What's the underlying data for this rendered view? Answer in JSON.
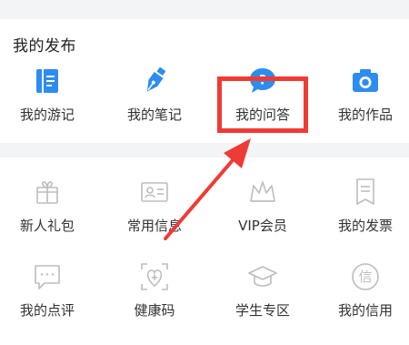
{
  "section_publish": {
    "title": "我的发布",
    "items": [
      {
        "label": "我的游记",
        "icon": "book-icon"
      },
      {
        "label": "我的笔记",
        "icon": "pen-icon"
      },
      {
        "label": "我的问答",
        "icon": "question-bubble-icon"
      },
      {
        "label": "我的作品",
        "icon": "camera-icon"
      }
    ]
  },
  "section_services": {
    "items": [
      {
        "label": "新人礼包",
        "icon": "gift-icon"
      },
      {
        "label": "常用信息",
        "icon": "id-card-icon"
      },
      {
        "label": "VIP会员",
        "icon": "crown-icon"
      },
      {
        "label": "我的发票",
        "icon": "invoice-icon"
      },
      {
        "label": "我的点评",
        "icon": "comment-icon"
      },
      {
        "label": "健康码",
        "icon": "health-code-icon"
      },
      {
        "label": "学生专区",
        "icon": "graduation-cap-icon"
      },
      {
        "label": "我的信用",
        "icon": "credit-icon"
      }
    ]
  },
  "colors": {
    "accent_blue": "#2d8cf0",
    "muted_icon": "#bdbdbd",
    "highlight_red": "#ef3b36",
    "band": "#f3f4f6"
  }
}
